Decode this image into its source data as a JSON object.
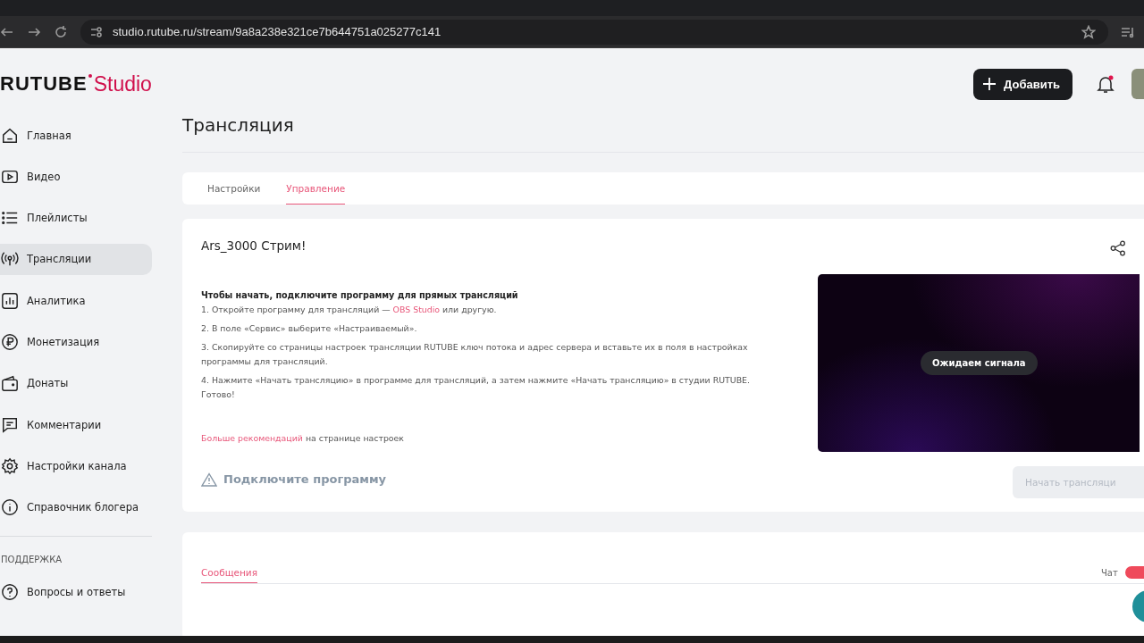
{
  "browser": {
    "url": "studio.rutube.ru/stream/9a8a238e321ce7b644751a025277c141"
  },
  "header": {
    "logo": "RUTUBE",
    "logo_suffix": "Studio",
    "add_button": "Добавить",
    "notifications_unread": true
  },
  "sidebar": {
    "items": [
      {
        "label": "Главная",
        "selected": false
      },
      {
        "label": "Видео",
        "selected": false
      },
      {
        "label": "Плейлисты",
        "selected": false
      },
      {
        "label": "Трансляции",
        "selected": true
      },
      {
        "label": "Аналитика",
        "selected": false
      },
      {
        "label": "Монетизация",
        "selected": false
      },
      {
        "label": "Донаты",
        "selected": false
      },
      {
        "label": "Комментарии",
        "selected": false
      },
      {
        "label": "Настройки канала",
        "selected": false
      },
      {
        "label": "Справочник блогера",
        "selected": false
      }
    ],
    "support_heading": "ПОДДЕРЖКА",
    "support_items": [
      {
        "label": "Вопросы и ответы",
        "selected": false
      }
    ]
  },
  "page_title": "Трансляция",
  "tabs": [
    {
      "label": "Настройки",
      "selected": false
    },
    {
      "label": "Управление",
      "selected": true
    }
  ],
  "stream": {
    "title": "Ars_3000 Стрим!",
    "instructions_heading": "Чтобы начать, подключите программу для прямых трансляций",
    "steps": [
      {
        "text": "1. Откройте программу для трансляций — ",
        "link": "OBS Studio",
        "after": " или другую."
      },
      {
        "text": "2. В поле «Сервис» выберите «Настраиваемый»."
      },
      {
        "text": "3. Скопируйте со страницы настроек трансляции RUTUBE ключ потока и адрес сервера и вставьте их в поля в настройках программы для трансляций."
      },
      {
        "text": "4. Нажмите «Начать трансляцию» в программе для трансляций, а затем нажмите «Начать трансляцию» в студии RUTUBE. Готово!"
      }
    ],
    "more_link": "Больше рекомендаций",
    "more_text": "на странице настроек",
    "status": "Подключите программу",
    "preview_badge": "Ожидаем сигнала",
    "start_button": {
      "label": "Начать трансляци",
      "disabled": true
    }
  },
  "messages": {
    "tabs": [
      {
        "label": "Сообщения",
        "selected": true
      }
    ],
    "chat_label": "Чат",
    "chat_on": true
  }
}
